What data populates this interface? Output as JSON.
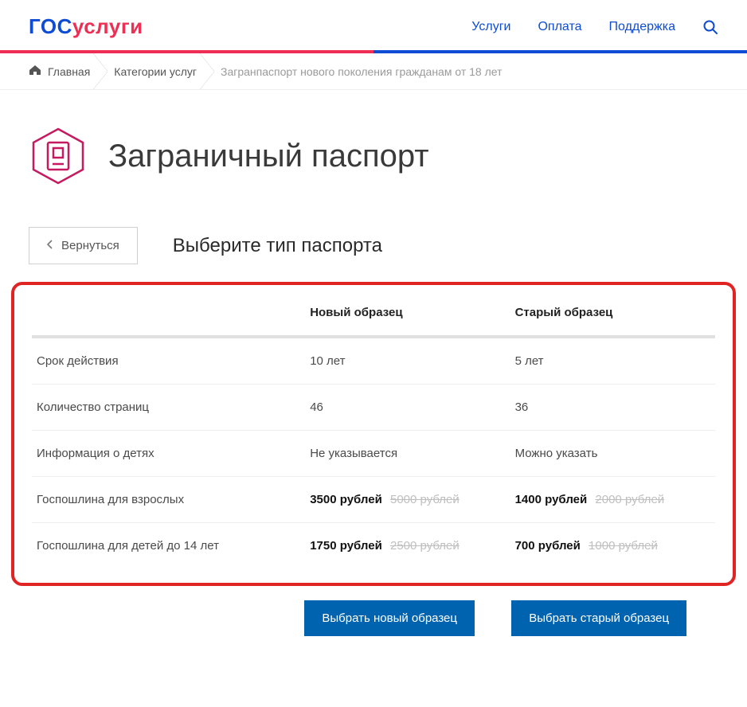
{
  "header": {
    "logo_part1": "гос",
    "logo_part2": "услуги",
    "nav": {
      "services": "Услуги",
      "payment": "Оплата",
      "support": "Поддержка"
    }
  },
  "breadcrumb": {
    "home": "Главная",
    "categories": "Категории услуг",
    "current": "Загранпаспорт нового поколения гражданам от 18 лет"
  },
  "page": {
    "title": "Заграничный паспорт",
    "back": "Вернуться",
    "subtitle": "Выберите тип паспорта"
  },
  "table": {
    "col_new": "Новый образец",
    "col_old": "Старый образец",
    "rows": {
      "validity": {
        "label": "Срок действия",
        "new": "10 лет",
        "old": "5 лет"
      },
      "pages": {
        "label": "Количество страниц",
        "new": "46",
        "old": "36"
      },
      "children": {
        "label": "Информация о детях",
        "new": "Не указывается",
        "old": "Можно указать"
      },
      "fee_adult": {
        "label": "Госпошлина для взрослых",
        "new_price": "3500 рублей",
        "new_strike": "5000 рублей",
        "old_price": "1400 рублей",
        "old_strike": "2000 рублей"
      },
      "fee_child": {
        "label": "Госпошлина для детей до 14 лет",
        "new_price": "1750 рублей",
        "new_strike": "2500 рублей",
        "old_price": "700 рублей",
        "old_strike": "1000 рублей"
      }
    }
  },
  "buttons": {
    "choose_new": "Выбрать новый образец",
    "choose_old": "Выбрать старый образец"
  }
}
